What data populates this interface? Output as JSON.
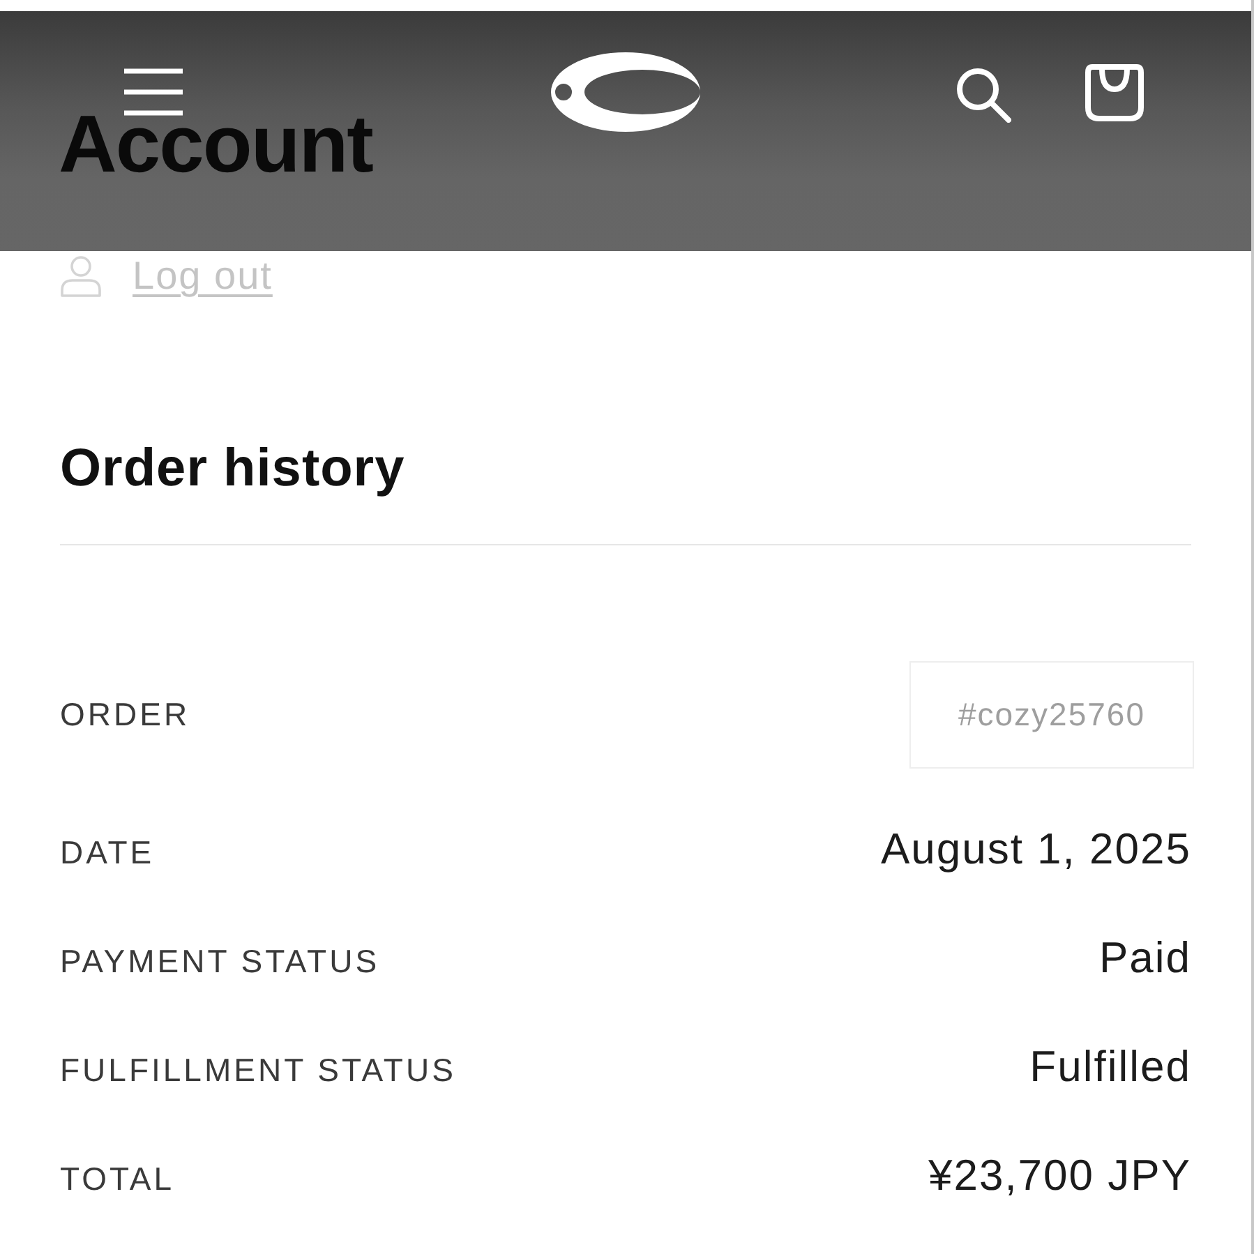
{
  "page": {
    "title": "Account",
    "logout_link": "Log out"
  },
  "order_history": {
    "title": "Order history",
    "rows": [
      {
        "kind": "link",
        "label": "ORDER",
        "value": "#cozy25760"
      },
      {
        "kind": "text",
        "label": "DATE",
        "value": "August 1, 2025"
      },
      {
        "kind": "text",
        "label": "PAYMENT STATUS",
        "value": "Paid"
      },
      {
        "kind": "text",
        "label": "FULFILLMENT STATUS",
        "value": "Fulfilled"
      },
      {
        "kind": "text",
        "label": "TOTAL",
        "value": "¥23,700 JPY"
      }
    ]
  }
}
